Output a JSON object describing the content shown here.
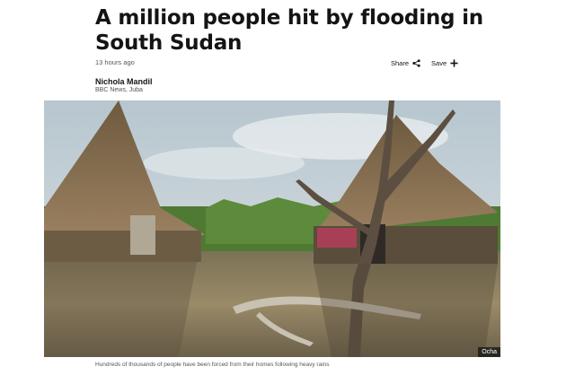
{
  "article": {
    "headline": "A million people hit by flooding in South Sudan",
    "timestamp": "13 hours ago",
    "author": {
      "name": "Nichola Mandil",
      "role": "BBC News, Juba"
    }
  },
  "actions": {
    "share_label": "Share",
    "save_label": "Save",
    "share_icon": "share-icon",
    "save_icon": "plus-icon"
  },
  "media": {
    "credit": "Ocha",
    "caption": "Hundreds of thousands of people have been forced from their homes following heavy rains"
  }
}
